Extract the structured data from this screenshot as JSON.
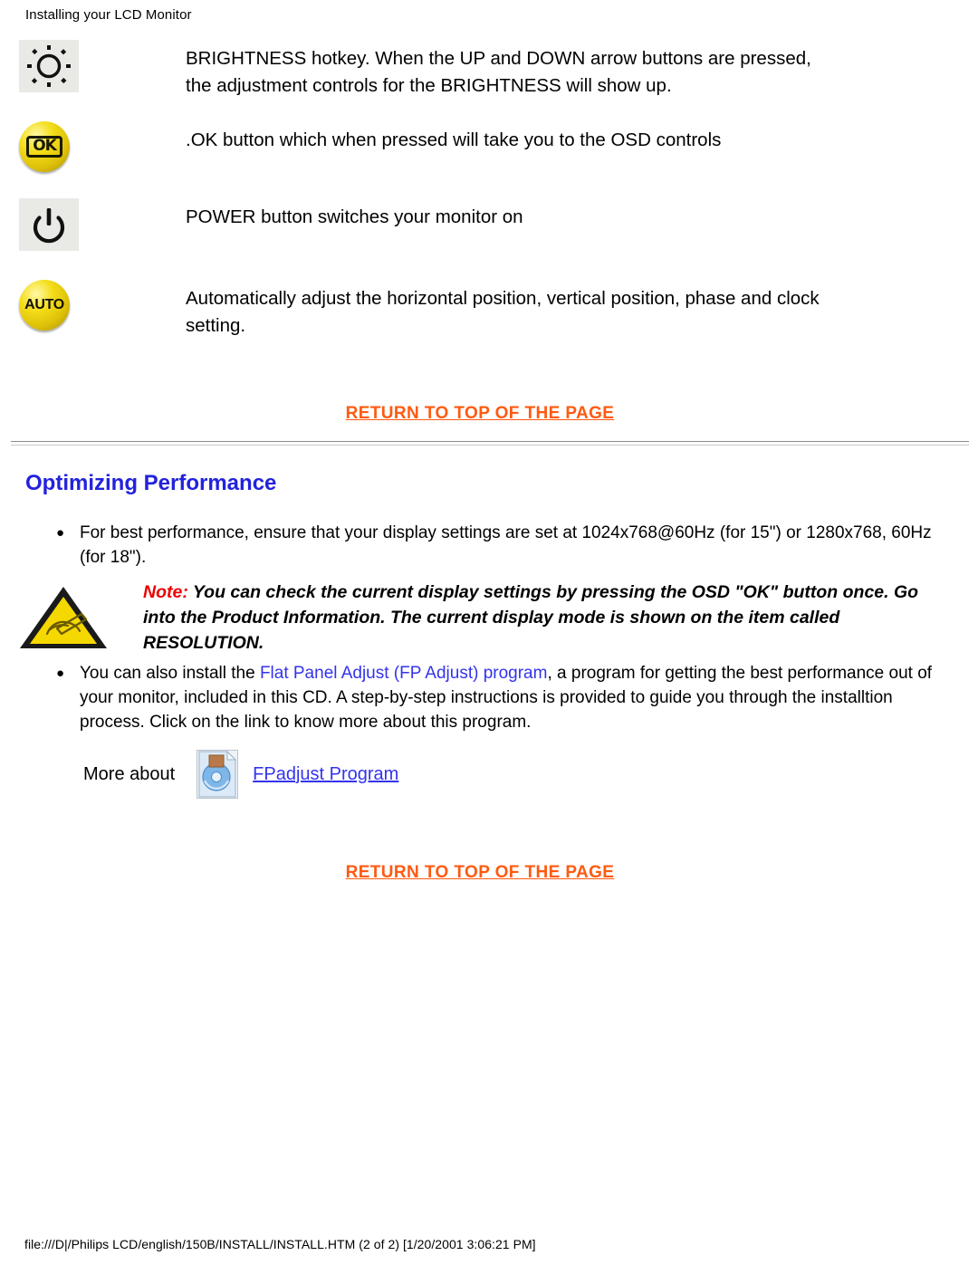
{
  "header": {
    "title": "Installing your LCD Monitor"
  },
  "button_rows": [
    {
      "icon": "brightness-sun-icon",
      "description": "BRIGHTNESS hotkey. When the UP and DOWN arrow buttons are pressed, the adjustment controls for the BRIGHTNESS will show up."
    },
    {
      "icon": "ok-button-icon",
      "icon_label": "OK",
      "description": ".OK button which when pressed will take you to the OSD controls"
    },
    {
      "icon": "power-button-icon",
      "description": "POWER button switches your monitor on"
    },
    {
      "icon": "auto-button-icon",
      "icon_label": "AUTO",
      "description": "Automatically adjust the horizontal position, vertical position, phase and clock setting."
    }
  ],
  "links": {
    "return_to_top": "RETURN TO TOP OF THE PAGE",
    "fp_adjust_inline": "Flat Panel Adjust (FP Adjust) program",
    "fpadjust_program": "FPadjust Program"
  },
  "section": {
    "heading": "Optimizing Performance"
  },
  "bullets": {
    "marker": "●",
    "first": "For best performance, ensure that your display settings are set at 1024x768@60Hz (for 15\") or 1280x768, 60Hz (for 18\").",
    "second_prefix": "You can also install the ",
    "second_suffix": ", a program for getting the best performance out of your monitor, included in this CD. A step-by-step instructions is provided to guide you through the installtion process. Click on the link to know more about this program."
  },
  "note": {
    "icon": "warning-triangle-icon",
    "label": "Note:",
    "text": " You can check the current display settings by pressing the OSD \"OK\" button once. Go into the Product Information. The current display mode is shown on the item called RESOLUTION."
  },
  "more_about": {
    "label": "More about",
    "icon": "floppy-disk-icon"
  },
  "footer": {
    "path": "file:///D|/Philips LCD/english/150B/INSTALL/INSTALL.HTM (2 of 2) [1/20/2001 3:06:21 PM]"
  },
  "colors": {
    "link_orange": "#ff5a10",
    "link_blue": "#3333ee",
    "heading_blue": "#2222dd",
    "note_red": "#ee0000",
    "button_gold": "#f4dd18"
  }
}
